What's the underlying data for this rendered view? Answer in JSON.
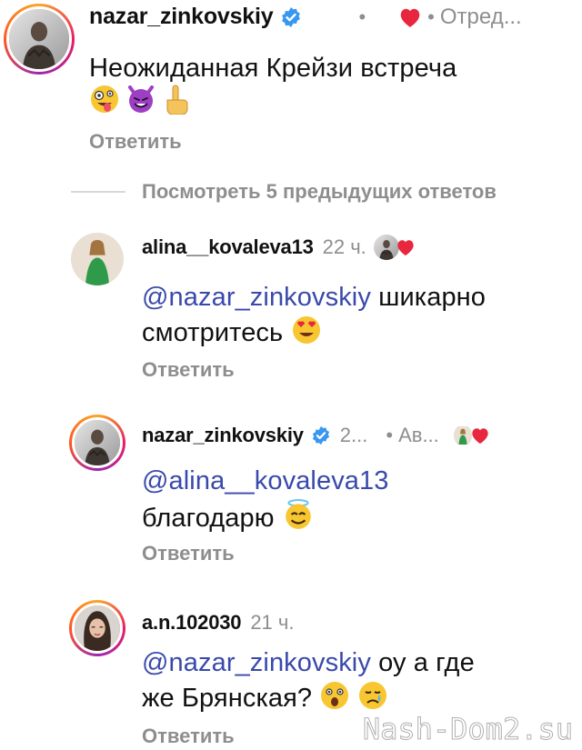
{
  "comments": [
    {
      "username": "nazar_zinkovskiy",
      "verified": true,
      "time": "",
      "meta_label": "Отред...",
      "text": "Неожиданная Крейзи встреча",
      "reply_label": "Ответить",
      "emojis": [
        "zany-face",
        "smiling-devil",
        "pointing-up"
      ]
    },
    {
      "username": "alina__kovaleva13",
      "verified": false,
      "time": "22 ч.",
      "mention": "@nazar_zinkovskiy",
      "text": "шикарно смотритесь",
      "reply_label": "Ответить",
      "emojis": [
        "heart-eyes"
      ]
    },
    {
      "username": "nazar_zinkovskiy",
      "verified": true,
      "time": "2...",
      "meta_label": "Ав...",
      "mention": "@alina__kovaleva13",
      "text": "благодарю",
      "reply_label": "Ответить",
      "emojis": [
        "halo-smile"
      ]
    },
    {
      "username": "a.n.102030",
      "verified": false,
      "time": "21 ч.",
      "mention": "@nazar_zinkovskiy",
      "text_line1": "оу а где",
      "text_line2": "же Брянская?",
      "reply_label": "Ответить",
      "emojis": [
        "astonished-face",
        "crying-face"
      ]
    }
  ],
  "view_more": {
    "label": "Посмотреть 5 предыдущих ответов"
  },
  "watermark": "Nash-Dom2.su",
  "colors": {
    "mention": "#3949ab",
    "gray": "#8e8e8e",
    "heart": "#e8263d",
    "verified": "#3897f0"
  }
}
